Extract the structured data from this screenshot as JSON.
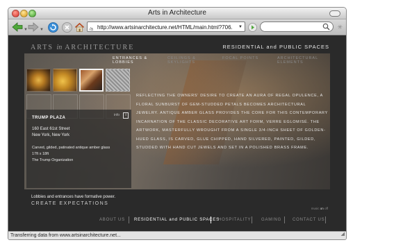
{
  "window": {
    "title": "Arts in Architecture"
  },
  "toolbar": {
    "url": "http://www.artsinarchitecture.net/HTML/main.html?706.",
    "search_placeholder": ""
  },
  "site": {
    "brand_prefix": "ARTS",
    "brand_in": "in",
    "brand_suffix": "ARCHITECTURE",
    "section_title": "RESIDENTIAL and PUBLIC SPACES",
    "subnav": [
      {
        "line1": "ENTRANCES &",
        "line2": "LOBBIES"
      },
      {
        "line1": "CEILINGS &",
        "line2": "SKYLIGHTS"
      },
      {
        "line1": "FOCAL POINTS",
        "line2": ""
      },
      {
        "line1": "ARCHITECTURAL",
        "line2": "ELEMENTS"
      }
    ],
    "info": {
      "name": "TRUMP PLAZA",
      "info_label": "info",
      "info_icon_text": "i",
      "address_line1": "160 East 61st Street",
      "address_line2": "New York, New York",
      "desc_line1": "Carved, gilded, patinated antique amber glass",
      "desc_line2": "17ft x 18ft",
      "desc_line3": "The Trump Organization"
    },
    "body_text": "REFLECTING THE OWNERS' DESIRE TO CREATE AN AURA OF REGAL OPULENCE, A FLORAL SUNBURST OF GEM-STUDDED PETALS BECOMES ARCHITECTURAL JEWELRY. ANTIQUE AMBER GLASS PROVIDES THE CORE FOR THIS CONTEMPORARY INCARNATION OF THE CLASSIC DECORATIVE ART FORM, VERRE EGLOMISÉ. THE ARTWORK, MASTERFULLY WROUGHT FROM A SINGLE 3/4-INCH SHEET OF GOLDEN-HUED GLASS, IS CARVED, GLUE CHIPPED, HAND SILVERED, PAINTED, GILDED, STUDDED WITH HAND CUT JEWELS AND SET IN A POLISHED BRASS FRAME.",
    "tagline": "Lobbies and entrances have formative power.",
    "cta": "CREATE EXPECTATIONS",
    "music_label": "music",
    "music_on": "on",
    "music_off": "off",
    "bottom_nav": [
      "ABOUT US",
      "RESIDENTIAL and PUBLIC SPACES",
      "HOSPITALITY",
      "GAMING",
      "CONTACT US"
    ]
  },
  "status": {
    "text": "Transferring data from www.artsinarchitecture.net..."
  }
}
